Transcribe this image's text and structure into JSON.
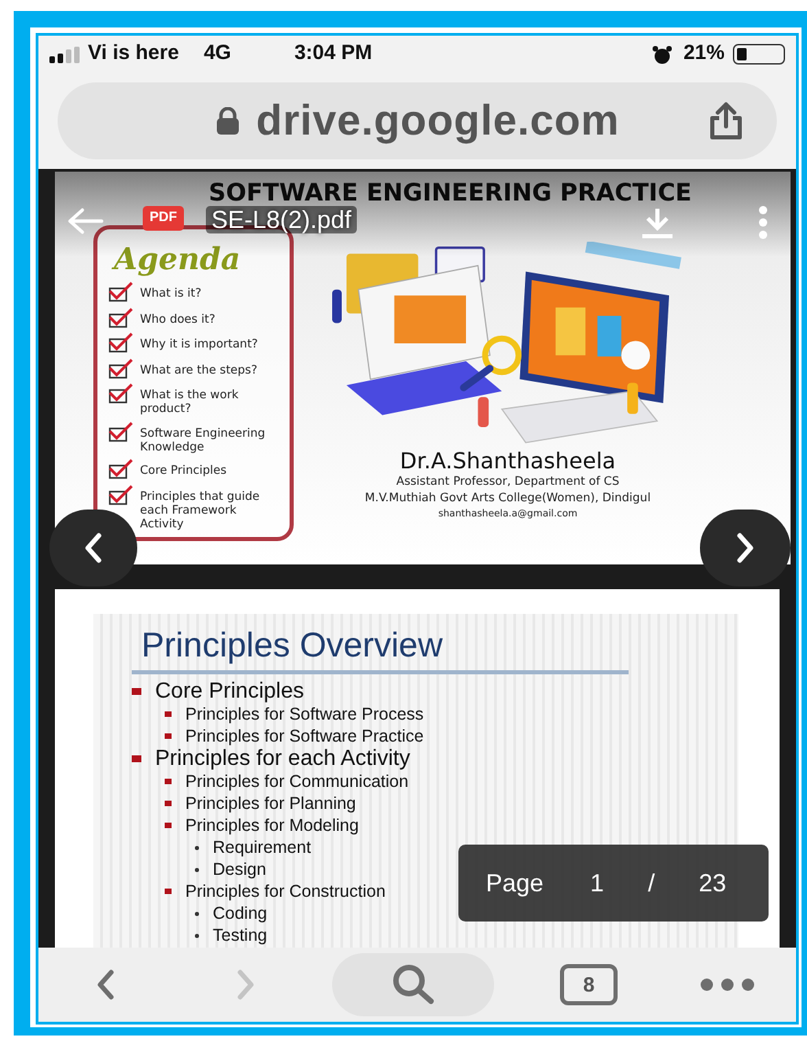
{
  "status_bar": {
    "carrier": "Vi is here",
    "network": "4G",
    "time": "3:04 PM",
    "battery": "21%"
  },
  "address_bar": {
    "url": "drive.google.com"
  },
  "viewer": {
    "file_badge": "PDF",
    "file_name": "SE-L8(2).pdf",
    "slide_1": {
      "title": "SOFTWARE ENGINEERING PRACTICE",
      "agenda_title": "Agenda",
      "agenda": [
        {
          "text": "What is it?",
          "checked": true
        },
        {
          "text": "Who does it?",
          "checked": true
        },
        {
          "text": "Why it is important?",
          "checked": true
        },
        {
          "text": "What are the steps?",
          "checked": true
        },
        {
          "text": "What is the work product?",
          "checked": true
        },
        {
          "text": "Software Engineering Knowledge",
          "checked": true
        },
        {
          "text": "Core Principles",
          "checked": true
        },
        {
          "text": "Principles that guide each Framework Activity",
          "checked": true
        }
      ],
      "author": "Dr.A.Shanthasheela",
      "role": "Assistant Professor, Department of CS",
      "college": "M.V.Muthiah Govt Arts College(Women), Dindigul",
      "email": "shanthasheela.a@gmail.com"
    },
    "slide_2": {
      "title": "Principles Overview",
      "outline": [
        {
          "text": "Core Principles",
          "children": [
            {
              "text": "Principles for Software Process"
            },
            {
              "text": "Principles for Software Practice"
            }
          ]
        },
        {
          "text": "Principles for each Activity",
          "children": [
            {
              "text": "Principles for Communication"
            },
            {
              "text": "Principles for Planning"
            },
            {
              "text": "Principles for Modeling",
              "children": [
                {
                  "text": "Requirement"
                },
                {
                  "text": "Design"
                }
              ]
            },
            {
              "text": "Principles for Construction",
              "children": [
                {
                  "text": "Coding"
                },
                {
                  "text": "Testing"
                }
              ]
            }
          ]
        }
      ]
    },
    "page_indicator": {
      "label": "Page",
      "current": "1",
      "separator": "/",
      "total": "23"
    }
  },
  "toolbar": {
    "back_disabled": false,
    "forward_disabled": true,
    "tab_count": "8"
  }
}
